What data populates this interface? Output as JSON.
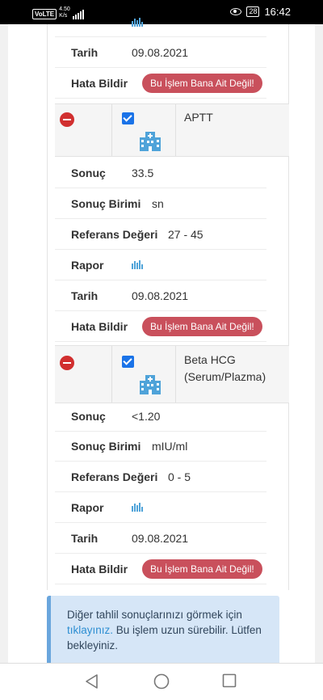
{
  "status_bar": {
    "network": "VoLTE",
    "speed_value": "4.50",
    "speed_unit": "K/s",
    "battery": "28",
    "time": "16:42"
  },
  "records": [
    {
      "hata_label": "Hata Bildir",
      "hata_button": "Bu İşlem Bana Ait Değil!",
      "tarih_label": "Tarih",
      "tarih_value": "09.08.2021"
    },
    {
      "test_name": "APTT",
      "sonuc_label": "Sonuç",
      "sonuc_value": "33.5",
      "birim_label": "Sonuç Birimi",
      "birim_value": "sn",
      "referans_label": "Referans Değeri",
      "referans_value": "27 - 45",
      "rapor_label": "Rapor",
      "tarih_label": "Tarih",
      "tarih_value": "09.08.2021",
      "hata_label": "Hata Bildir",
      "hata_button": "Bu İşlem Bana Ait Değil!"
    },
    {
      "test_name_line1": "Beta HCG",
      "test_name_line2": "(Serum/Plazma)",
      "sonuc_label": "Sonuç",
      "sonuc_value": "<1.20",
      "birim_label": "Sonuç Birimi",
      "birim_value": "mIU/ml",
      "referans_label": "Referans Değeri",
      "referans_value": "0 - 5",
      "rapor_label": "Rapor",
      "tarih_label": "Tarih",
      "tarih_value": "09.08.2021",
      "hata_label": "Hata Bildir",
      "hata_button": "Bu İşlem Bana Ait Değil!"
    }
  ],
  "info": {
    "text_before": "Diğer tahlil sonuçlarınızı görmek için",
    "link": "tıklayınız.",
    "text_after": "Bu işlem uzun sürebilir. Lütfen bekleyiniz."
  },
  "colors": {
    "danger_button": "#c9505c",
    "link": "#2d8ed2",
    "checkbox": "#1a73e8",
    "icon_blue": "#4fa3d9"
  }
}
